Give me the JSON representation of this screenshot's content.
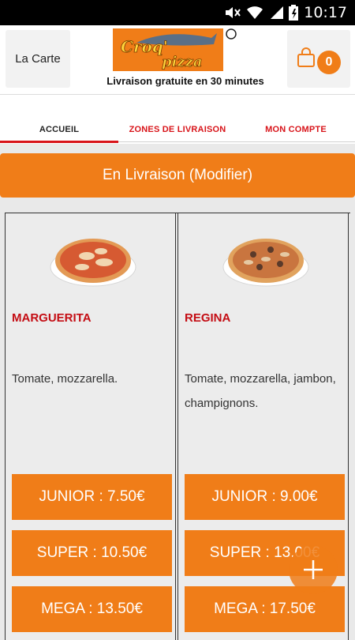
{
  "status_bar": {
    "time": "10:17"
  },
  "header": {
    "menu_label": "La Carte",
    "logo_text": {
      "line1": "Croq'",
      "line2": "pizza"
    },
    "tagline": "Livraison gratuite en 30 minutes",
    "cart_count": "0"
  },
  "tabs": [
    {
      "label": "ACCUEIL",
      "active": true
    },
    {
      "label": "ZONES DE LIVRAISON",
      "active": false
    },
    {
      "label": "MON COMPTE",
      "active": false
    }
  ],
  "delivery_label": "En Livraison (Modifier)",
  "products": [
    {
      "name": "MARGUERITA",
      "description": "Tomate, mozzarella.",
      "prices": [
        "JUNIOR : 7.50€",
        "SUPER : 10.50€",
        "MEGA : 13.50€"
      ]
    },
    {
      "name": "REGINA",
      "description": "Tomate, mozzarella, jambon, champignons.",
      "prices": [
        "JUNIOR : 9.00€",
        "SUPER : 13.00€",
        "MEGA : 17.50€"
      ]
    }
  ],
  "colors": {
    "accent": "#f07d18",
    "red": "#d8141a",
    "name_red": "#c40d14"
  },
  "icons": [
    "mute-icon",
    "wifi-icon",
    "signal-icon",
    "battery-icon",
    "shopping-bag-icon",
    "plus-icon"
  ]
}
